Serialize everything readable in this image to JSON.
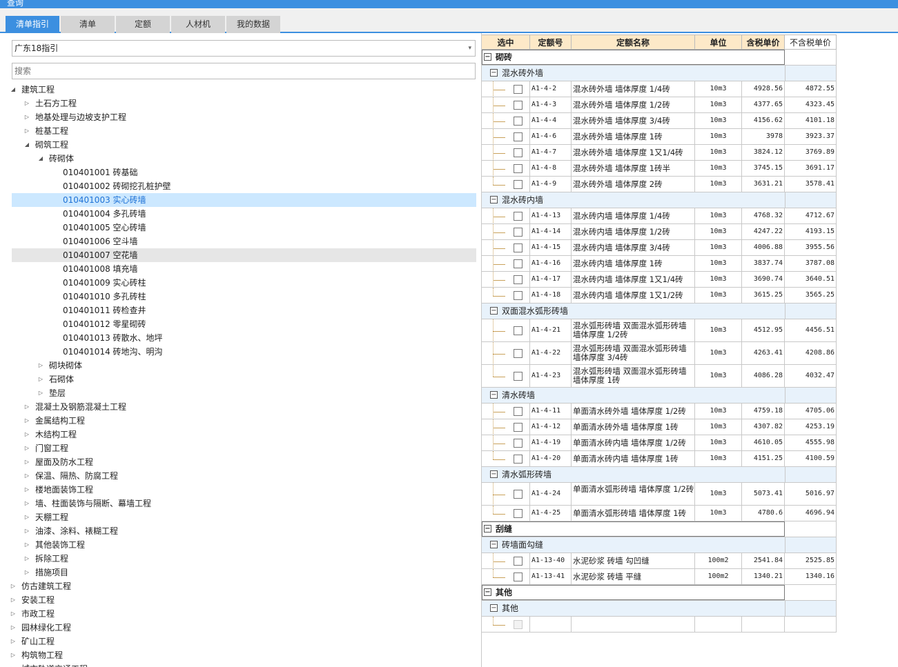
{
  "window": {
    "title": "查询"
  },
  "tabs": [
    {
      "label": "清单指引",
      "active": true
    },
    {
      "label": "清单",
      "active": false
    },
    {
      "label": "定额",
      "active": false
    },
    {
      "label": "人材机",
      "active": false
    },
    {
      "label": "我的数据",
      "active": false
    }
  ],
  "left": {
    "guide_select": {
      "value": "广东18指引"
    },
    "search": {
      "placeholder": "搜索"
    },
    "tree": [
      {
        "label": "建筑工程",
        "level": 0,
        "expanded": true
      },
      {
        "label": "土石方工程",
        "level": 1,
        "expanded": false
      },
      {
        "label": "地基处理与边坡支护工程",
        "level": 1,
        "expanded": false
      },
      {
        "label": "桩基工程",
        "level": 1,
        "expanded": false
      },
      {
        "label": "砌筑工程",
        "level": 1,
        "expanded": true
      },
      {
        "label": "砖砌体",
        "level": 2,
        "expanded": true
      },
      {
        "label": "010401001  砖基础",
        "level": 3
      },
      {
        "label": "010401002  砖砌挖孔桩护壁",
        "level": 3
      },
      {
        "label": "010401003  实心砖墙",
        "level": 3,
        "selected": true
      },
      {
        "label": "010401004  多孔砖墙",
        "level": 3
      },
      {
        "label": "010401005  空心砖墙",
        "level": 3
      },
      {
        "label": "010401006  空斗墙",
        "level": 3
      },
      {
        "label": "010401007  空花墙",
        "level": 3,
        "hover": true
      },
      {
        "label": "010401008  填充墙",
        "level": 3
      },
      {
        "label": "010401009  实心砖柱",
        "level": 3
      },
      {
        "label": "010401010  多孔砖柱",
        "level": 3
      },
      {
        "label": "010401011  砖检查井",
        "level": 3
      },
      {
        "label": "010401012  零星砌砖",
        "level": 3
      },
      {
        "label": "010401013  砖散水、地坪",
        "level": 3
      },
      {
        "label": "010401014  砖地沟、明沟",
        "level": 3
      },
      {
        "label": "砌块砌体",
        "level": 2,
        "expanded": false
      },
      {
        "label": "石砌体",
        "level": 2,
        "expanded": false
      },
      {
        "label": "垫层",
        "level": 2,
        "expanded": false
      },
      {
        "label": "混凝土及钢筋混凝土工程",
        "level": 1,
        "expanded": false
      },
      {
        "label": "金属结构工程",
        "level": 1,
        "expanded": false
      },
      {
        "label": "木结构工程",
        "level": 1,
        "expanded": false
      },
      {
        "label": "门窗工程",
        "level": 1,
        "expanded": false
      },
      {
        "label": "屋面及防水工程",
        "level": 1,
        "expanded": false
      },
      {
        "label": "保温、隔热、防腐工程",
        "level": 1,
        "expanded": false
      },
      {
        "label": "楼地面装饰工程",
        "level": 1,
        "expanded": false
      },
      {
        "label": "墙、柱面装饰与隔断、幕墙工程",
        "level": 1,
        "expanded": false
      },
      {
        "label": "天棚工程",
        "level": 1,
        "expanded": false
      },
      {
        "label": "油漆、涂料、裱糊工程",
        "level": 1,
        "expanded": false
      },
      {
        "label": "其他装饰工程",
        "level": 1,
        "expanded": false
      },
      {
        "label": "拆除工程",
        "level": 1,
        "expanded": false
      },
      {
        "label": "措施项目",
        "level": 1,
        "expanded": false
      },
      {
        "label": "仿古建筑工程",
        "level": 0,
        "expanded": false
      },
      {
        "label": "安装工程",
        "level": 0,
        "expanded": false
      },
      {
        "label": "市政工程",
        "level": 0,
        "expanded": false
      },
      {
        "label": "园林绿化工程",
        "level": 0,
        "expanded": false
      },
      {
        "label": "矿山工程",
        "level": 0,
        "expanded": false
      },
      {
        "label": "构筑物工程",
        "level": 0,
        "expanded": false
      },
      {
        "label": "城市轨道交通工程",
        "level": 0,
        "expanded": false
      }
    ]
  },
  "grid": {
    "columns": [
      "选中",
      "定额号",
      "定额名称",
      "单位",
      "含税单价",
      "不含税单价"
    ],
    "rows": [
      {
        "type": "group1",
        "label": "砌砖"
      },
      {
        "type": "group2",
        "label": "混水砖外墙"
      },
      {
        "type": "item",
        "code": "A1-4-2",
        "name": "混水砖外墙 墙体厚度 1/4砖",
        "unit": "10m3",
        "price_tax": "4928.56",
        "price_notax": "4872.55"
      },
      {
        "type": "item",
        "code": "A1-4-3",
        "name": "混水砖外墙 墙体厚度 1/2砖",
        "unit": "10m3",
        "price_tax": "4377.65",
        "price_notax": "4323.45"
      },
      {
        "type": "item",
        "code": "A1-4-4",
        "name": "混水砖外墙 墙体厚度 3/4砖",
        "unit": "10m3",
        "price_tax": "4156.62",
        "price_notax": "4101.18"
      },
      {
        "type": "item",
        "code": "A1-4-6",
        "name": "混水砖外墙 墙体厚度 1砖",
        "unit": "10m3",
        "price_tax": "3978",
        "price_notax": "3923.37"
      },
      {
        "type": "item",
        "code": "A1-4-7",
        "name": "混水砖外墙 墙体厚度 1又1/4砖",
        "unit": "10m3",
        "price_tax": "3824.12",
        "price_notax": "3769.89"
      },
      {
        "type": "item",
        "code": "A1-4-8",
        "name": "混水砖外墙 墙体厚度 1砖半",
        "unit": "10m3",
        "price_tax": "3745.15",
        "price_notax": "3691.17"
      },
      {
        "type": "item",
        "code": "A1-4-9",
        "name": "混水砖外墙 墙体厚度 2砖",
        "unit": "10m3",
        "price_tax": "3631.21",
        "price_notax": "3578.41"
      },
      {
        "type": "group2",
        "label": "混水砖内墙"
      },
      {
        "type": "item",
        "code": "A1-4-13",
        "name": "混水砖内墙 墙体厚度 1/4砖",
        "unit": "10m3",
        "price_tax": "4768.32",
        "price_notax": "4712.67"
      },
      {
        "type": "item",
        "code": "A1-4-14",
        "name": "混水砖内墙 墙体厚度 1/2砖",
        "unit": "10m3",
        "price_tax": "4247.22",
        "price_notax": "4193.15"
      },
      {
        "type": "item",
        "code": "A1-4-15",
        "name": "混水砖内墙 墙体厚度 3/4砖",
        "unit": "10m3",
        "price_tax": "4006.88",
        "price_notax": "3955.56"
      },
      {
        "type": "item",
        "code": "A1-4-16",
        "name": "混水砖内墙 墙体厚度 1砖",
        "unit": "10m3",
        "price_tax": "3837.74",
        "price_notax": "3787.08"
      },
      {
        "type": "item",
        "code": "A1-4-17",
        "name": "混水砖内墙 墙体厚度 1又1/4砖",
        "unit": "10m3",
        "price_tax": "3690.74",
        "price_notax": "3640.51"
      },
      {
        "type": "item",
        "code": "A1-4-18",
        "name": "混水砖内墙 墙体厚度 1又1/2砖",
        "unit": "10m3",
        "price_tax": "3615.25",
        "price_notax": "3565.25"
      },
      {
        "type": "group2",
        "label": "双面混水弧形砖墙"
      },
      {
        "type": "item",
        "tall": true,
        "code": "A1-4-21",
        "name": "混水弧形砖墙 双面混水弧形砖墙 墙体厚度 1/2砖",
        "unit": "10m3",
        "price_tax": "4512.95",
        "price_notax": "4456.51"
      },
      {
        "type": "item",
        "tall": true,
        "code": "A1-4-22",
        "name": "混水弧形砖墙 双面混水弧形砖墙 墙体厚度 3/4砖",
        "unit": "10m3",
        "price_tax": "4263.41",
        "price_notax": "4208.86"
      },
      {
        "type": "item",
        "tall": true,
        "code": "A1-4-23",
        "name": "混水弧形砖墙 双面混水弧形砖墙 墙体厚度 1砖",
        "unit": "10m3",
        "price_tax": "4086.28",
        "price_notax": "4032.47"
      },
      {
        "type": "group2",
        "label": "清水砖墙"
      },
      {
        "type": "item",
        "code": "A1-4-11",
        "name": "单面清水砖外墙 墙体厚度 1/2砖",
        "unit": "10m3",
        "price_tax": "4759.18",
        "price_notax": "4705.06"
      },
      {
        "type": "item",
        "code": "A1-4-12",
        "name": "单面清水砖外墙 墙体厚度 1砖",
        "unit": "10m3",
        "price_tax": "4307.82",
        "price_notax": "4253.19"
      },
      {
        "type": "item",
        "code": "A1-4-19",
        "name": "单面清水砖内墙 墙体厚度 1/2砖",
        "unit": "10m3",
        "price_tax": "4610.05",
        "price_notax": "4555.98"
      },
      {
        "type": "item",
        "code": "A1-4-20",
        "name": "单面清水砖内墙 墙体厚度 1砖",
        "unit": "10m3",
        "price_tax": "4151.25",
        "price_notax": "4100.59"
      },
      {
        "type": "group2",
        "label": "清水弧形砖墙"
      },
      {
        "type": "item",
        "tall": true,
        "code": "A1-4-24",
        "name": "单面清水弧形砖墙 墙体厚度 1/2砖",
        "unit": "10m3",
        "price_tax": "5073.41",
        "price_notax": "5016.97"
      },
      {
        "type": "item",
        "code": "A1-4-25",
        "name": "单面清水弧形砖墙 墙体厚度 1砖",
        "unit": "10m3",
        "price_tax": "4780.6",
        "price_notax": "4696.94"
      },
      {
        "type": "group1",
        "label": "刮缝"
      },
      {
        "type": "group2",
        "label": "砖墙面勾缝"
      },
      {
        "type": "item",
        "code": "A1-13-40",
        "name": "水泥砂浆 砖墙 勾凹缝",
        "unit": "100m2",
        "price_tax": "2541.84",
        "price_notax": "2525.85"
      },
      {
        "type": "item",
        "code": "A1-13-41",
        "name": "水泥砂浆 砖墙 平缝",
        "unit": "100m2",
        "price_tax": "1340.21",
        "price_notax": "1340.16"
      },
      {
        "type": "group1",
        "label": "其他"
      },
      {
        "type": "group2",
        "label": "其他"
      },
      {
        "type": "item",
        "empty": true,
        "code": "",
        "name": "",
        "unit": "",
        "price_tax": "",
        "price_notax": ""
      }
    ]
  }
}
